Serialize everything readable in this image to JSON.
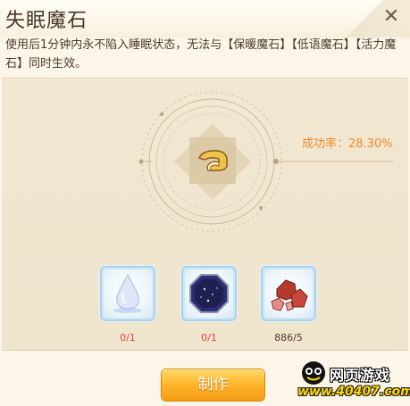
{
  "dialog": {
    "title": "失眠魔石",
    "close_icon": "close-x",
    "description": "使用后1分钟内永不陷入睡眠状态，无法与【保暖魔石】【低语魔石】【活力魔石】同时生效。"
  },
  "craft": {
    "item_icon": "cheese-roll-item",
    "success_rate_text": "成功率：28.30%",
    "success_rate": 0.283
  },
  "materials": [
    {
      "name": "water-droplet-crystal",
      "count": "0/1",
      "status": "insufficient"
    },
    {
      "name": "starry-octagon-gem",
      "count": "0/1",
      "status": "insufficient"
    },
    {
      "name": "red-ore-stones",
      "count": "886/5",
      "status": "sufficient"
    }
  ],
  "button": {
    "label": "制作"
  },
  "watermark": {
    "line1": "网页游戏",
    "line2": "www.40407.com"
  },
  "colors": {
    "accent": "#ef8a2a",
    "insufficient": "#e0473a",
    "button": "#ffb82f"
  }
}
